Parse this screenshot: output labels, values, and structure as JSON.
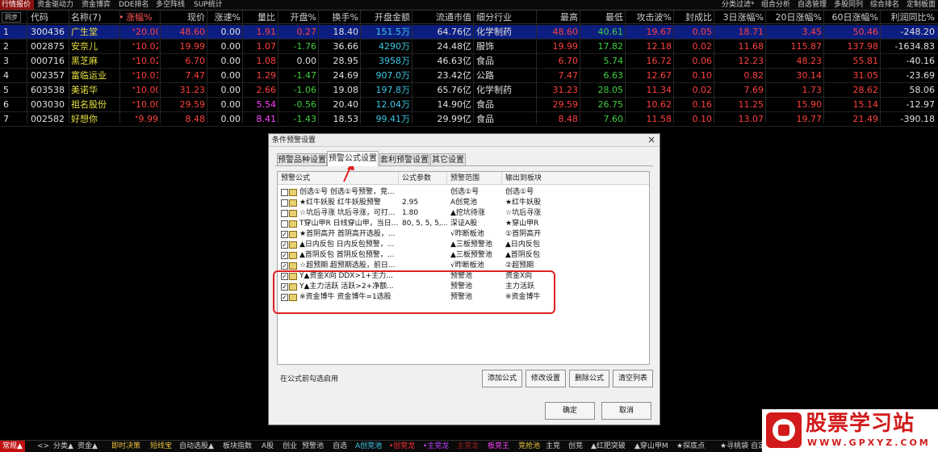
{
  "top_tabs": [
    "行情报价",
    "资金驱动力",
    "资金博弈",
    "DDE排名",
    "多空阵线",
    "SUP统计"
  ],
  "top_right_links": [
    "分类过滤*",
    "组合分析",
    "自选管理",
    "多股同列",
    "综合排名",
    "定制板面"
  ],
  "table": {
    "corner_label": "同步",
    "headers": [
      "代码",
      "名称(7)",
      "•",
      "涨幅%",
      "现价",
      "涨速%",
      "量比",
      "开盘%",
      "换手%",
      "开盘金额",
      "流通市值",
      "细分行业",
      "最高",
      "最低",
      "攻击波%",
      "封成比",
      "3日涨幅%",
      "20日涨幅%",
      "60日涨幅%",
      "利润同比%"
    ],
    "rows": [
      {
        "idx": "1",
        "code": "300436",
        "name": "广生堂",
        "chg": "20.00",
        "price": "48.60",
        "speed": "0.00",
        "vol_ratio": "1.91",
        "open_pct": "0.27",
        "turnover": "18.40",
        "open_amt": "151.5万",
        "float_cap": "64.76亿",
        "industry": "化学制药",
        "high": "48.60",
        "low": "40.61",
        "attack": "19.67",
        "seal": "0.05",
        "d3": "18.71",
        "d20": "3.45",
        "d60": "50.46",
        "profit": "-248.20"
      },
      {
        "idx": "2",
        "code": "002875",
        "name": "安奈儿",
        "chg": "10.02",
        "price": "19.99",
        "speed": "0.00",
        "vol_ratio": "1.07",
        "open_pct": "-1.76",
        "turnover": "36.66",
        "open_amt": "4290万",
        "float_cap": "24.48亿",
        "industry": "服饰",
        "high": "19.99",
        "low": "17.82",
        "attack": "12.18",
        "seal": "0.02",
        "d3": "11.68",
        "d20": "115.87",
        "d60": "137.98",
        "profit": "-1634.83"
      },
      {
        "idx": "3",
        "code": "000716",
        "name": "黑芝麻",
        "chg": "10.02",
        "price": "6.70",
        "speed": "0.00",
        "vol_ratio": "1.08",
        "open_pct": "0.00",
        "turnover": "28.95",
        "open_amt": "3958万",
        "float_cap": "46.63亿",
        "industry": "食品",
        "high": "6.70",
        "low": "5.74",
        "attack": "16.72",
        "seal": "0.06",
        "d3": "12.23",
        "d20": "48.23",
        "d60": "55.81",
        "profit": "-40.16"
      },
      {
        "idx": "4",
        "code": "002357",
        "name": "富临运业",
        "chg": "10.01",
        "price": "7.47",
        "speed": "0.00",
        "vol_ratio": "1.29",
        "open_pct": "-1.47",
        "turnover": "24.69",
        "open_amt": "907.0万",
        "float_cap": "23.42亿",
        "industry": "公路",
        "high": "7.47",
        "low": "6.63",
        "attack": "12.67",
        "seal": "0.10",
        "d3": "0.82",
        "d20": "30.14",
        "d60": "31.05",
        "profit": "-23.69"
      },
      {
        "idx": "5",
        "code": "603538",
        "name": "美诺华",
        "chg": "10.00",
        "price": "31.23",
        "speed": "0.00",
        "vol_ratio": "2.66",
        "open_pct": "-1.06",
        "turnover": "19.08",
        "open_amt": "197.8万",
        "float_cap": "65.76亿",
        "industry": "化学制药",
        "high": "31.23",
        "low": "28.05",
        "attack": "11.34",
        "seal": "0.02",
        "d3": "7.69",
        "d20": "1.73",
        "d60": "28.62",
        "profit": "58.06"
      },
      {
        "idx": "6",
        "code": "003030",
        "name": "祖名股份",
        "chg": "10.00",
        "price": "29.59",
        "speed": "0.00",
        "vol_ratio": "5.54",
        "open_pct": "-0.56",
        "turnover": "20.40",
        "open_amt": "12.04万",
        "float_cap": "14.90亿",
        "industry": "食品",
        "high": "29.59",
        "low": "26.75",
        "attack": "10.62",
        "seal": "0.16",
        "d3": "11.25",
        "d20": "15.90",
        "d60": "15.14",
        "profit": "-12.97"
      },
      {
        "idx": "7",
        "code": "002582",
        "name": "好想你",
        "chg": "9.99",
        "price": "8.48",
        "speed": "0.00",
        "vol_ratio": "8.41",
        "open_pct": "-1.43",
        "turnover": "18.53",
        "open_amt": "99.41万",
        "float_cap": "29.99亿",
        "industry": "食品",
        "high": "8.48",
        "low": "7.60",
        "attack": "11.58",
        "seal": "0.10",
        "d3": "13.07",
        "d20": "19.77",
        "d60": "21.49",
        "profit": "-390.18"
      }
    ]
  },
  "dialog": {
    "title": "条件预警设置",
    "close_glyph": "×",
    "tabs": [
      "预警品种设置",
      "预警公式设置",
      "套利预警设置",
      "其它设置"
    ],
    "active_tab": 1,
    "columns": [
      "预警公式",
      "公式参数",
      "预警范围",
      "输出到板块"
    ],
    "items": [
      {
        "checked": false,
        "formula": "创选①号 创选①号预警，竞...",
        "params": "",
        "range": "创选①号",
        "output": "创选①号"
      },
      {
        "checked": false,
        "formula": "★红牛妖股 红牛妖股预警",
        "params": "2.95",
        "range": "A创竞池",
        "output": "★红牛妖股"
      },
      {
        "checked": false,
        "formula": "☆坑后寻涨 坑后寻涨，可打...",
        "params": "1.80",
        "range": "▲挖坑待涨",
        "output": "☆坑后寻涨"
      },
      {
        "checked": false,
        "formula": "T穿山甲R 日线穿山甲，当日...",
        "params": "80, 5, 5, 5,...",
        "range": "深证A股",
        "output": "★穿山甲R"
      },
      {
        "checked": true,
        "formula": "★首阴高开 首阴高开选股，...",
        "params": "",
        "range": "√昨断板池",
        "output": "①首阴高开"
      },
      {
        "checked": true,
        "formula": "▲日内反包 日内反包预警，...",
        "params": "",
        "range": "▲三板预警池",
        "output": "▲日内反包"
      },
      {
        "checked": true,
        "formula": "▲首阴反包 首阴反包预警，...",
        "params": "",
        "range": "▲三板预警池",
        "output": "▲首阴反包"
      },
      {
        "checked": true,
        "formula": "☆超预期 超预期选股，前日...",
        "params": "",
        "range": "√昨断板池",
        "output": "②超预期"
      },
      {
        "checked": true,
        "formula": "Y▲资金X向 DDX>1+主力...",
        "params": "",
        "range": "预警池",
        "output": "资金X向"
      },
      {
        "checked": true,
        "formula": "Y▲主力活跃 活跃>2+净额...",
        "params": "",
        "range": "预警池",
        "output": "主力活跃"
      },
      {
        "checked": true,
        "formula": "※资金博牛 资金博牛=1选股",
        "params": "",
        "range": "预警池",
        "output": "※资金博牛"
      }
    ],
    "check_glyph": "✓",
    "hint": "在公式前勾选启用",
    "buttons": {
      "add": "添加公式",
      "modify": "修改设置",
      "delete": "删除公式",
      "clear": "清空列表",
      "ok": "确定",
      "cancel": "取消"
    }
  },
  "bottom_tabs": [
    {
      "label": "常规▲",
      "color": "#ffffff"
    },
    {
      "label": "<>",
      "color": "#cfcfcf"
    },
    {
      "label": "分类▲",
      "color": "#cfcfcf"
    },
    {
      "label": "资金▲",
      "color": "#cfcfcf"
    },
    {
      "label": "即时决策",
      "color": "#e8c040"
    },
    {
      "label": "短线宝",
      "color": "#e8c040"
    },
    {
      "label": "自动选股▲",
      "color": "#cfcfcf"
    },
    {
      "label": "板块指数",
      "color": "#cfcfcf"
    },
    {
      "label": "A股",
      "color": "#cfcfcf"
    },
    {
      "label": "创业",
      "color": "#cfcfcf"
    },
    {
      "label": "预警池",
      "color": "#cfcfcf"
    },
    {
      "label": "自选",
      "color": "#cfcfcf"
    },
    {
      "label": "A创竞池",
      "color": "#40c8e8"
    },
    {
      "label": "•创竞龙",
      "color": "#ff3030"
    },
    {
      "label": "•主竞龙",
      "color": "#c040ff"
    },
    {
      "label": "主竞龙",
      "color": "#a02020"
    },
    {
      "label": "板竞王",
      "color": "#ff40ff"
    },
    {
      "label": "竞抢池",
      "color": "#e8c040"
    },
    {
      "label": "主竞",
      "color": "#cfcfcf"
    },
    {
      "label": "创竞",
      "color": "#cfcfcf"
    },
    {
      "label": "▲红肥突破",
      "color": "#cfcfcf"
    },
    {
      "label": "▲穿山甲M",
      "color": "#cfcfcf"
    },
    {
      "label": "★探底点",
      "color": "#cfcfcf"
    },
    {
      "label": "★寻桃袋",
      "color": "#cfcfcf"
    },
    {
      "label": "自定",
      "color": "#cfcfcf"
    }
  ],
  "logo": {
    "title": "股票学习站",
    "url": "WWW.GPXYZ.COM"
  }
}
